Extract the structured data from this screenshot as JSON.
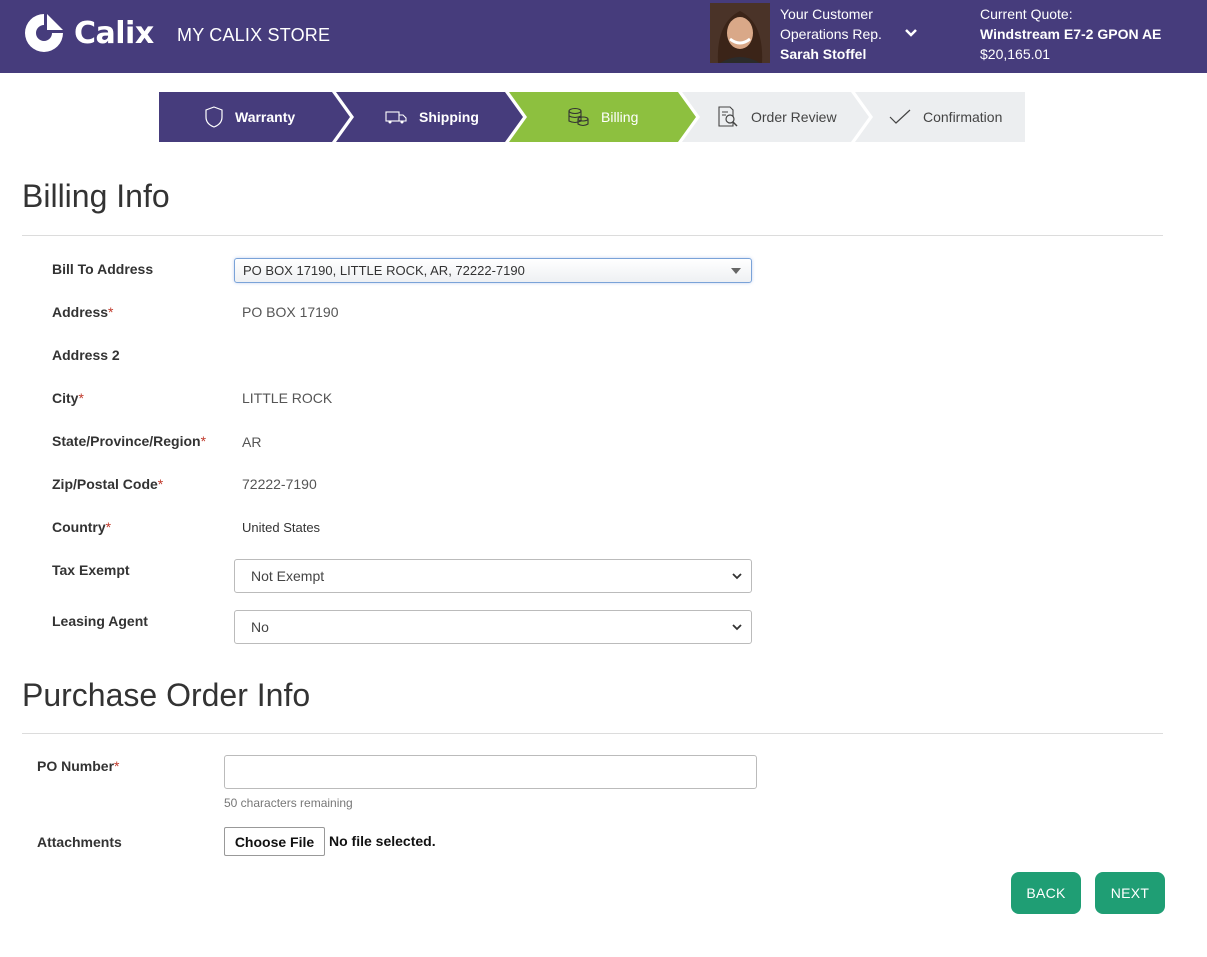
{
  "header": {
    "brand": "Calix",
    "store_title": "MY CALIX STORE",
    "rep_line1": "Your Customer",
    "rep_line2": "Operations Rep.",
    "rep_name": "Sarah Stoffel",
    "quote_label": "Current Quote:",
    "quote_name": "Windstream E7-2 GPON AE",
    "quote_amount": "$20,165.01"
  },
  "steps": [
    {
      "label": "Warranty",
      "icon": "shield-icon",
      "state": "done"
    },
    {
      "label": "Shipping",
      "icon": "truck-icon",
      "state": "done"
    },
    {
      "label": "Billing",
      "icon": "coins-icon",
      "state": "active"
    },
    {
      "label": "Order Review",
      "icon": "document-search-icon",
      "state": "pending"
    },
    {
      "label": "Confirmation",
      "icon": "checkmark-icon",
      "state": "pending"
    }
  ],
  "colors": {
    "header": "#463c7c",
    "active": "#8dc03f",
    "pending": "#eceef0",
    "button": "#1f9e74"
  },
  "billing": {
    "title": "Billing Info",
    "bill_to_label": "Bill To Address",
    "bill_to_value": "PO BOX 17190, LITTLE ROCK, AR, 72222-7190",
    "address_label": "Address",
    "address_value": "PO BOX 17190",
    "address2_label": "Address 2",
    "city_label": "City",
    "city_value": "LITTLE ROCK",
    "state_label": "State/Province/Region",
    "state_value": "AR",
    "zip_label": "Zip/Postal Code",
    "zip_value": "72222-7190",
    "country_label": "Country",
    "country_value": "United States",
    "tax_label": "Tax Exempt",
    "tax_value": "Not Exempt",
    "leasing_label": "Leasing Agent",
    "leasing_value": "No",
    "required_mark": "*"
  },
  "po": {
    "title": "Purchase Order Info",
    "number_label": "PO Number",
    "number_value": "",
    "remaining": "50 characters remaining",
    "attachments_label": "Attachments",
    "choose_file": "Choose File",
    "no_file": "No file selected."
  },
  "actions": {
    "back": "BACK",
    "next": "NEXT"
  }
}
